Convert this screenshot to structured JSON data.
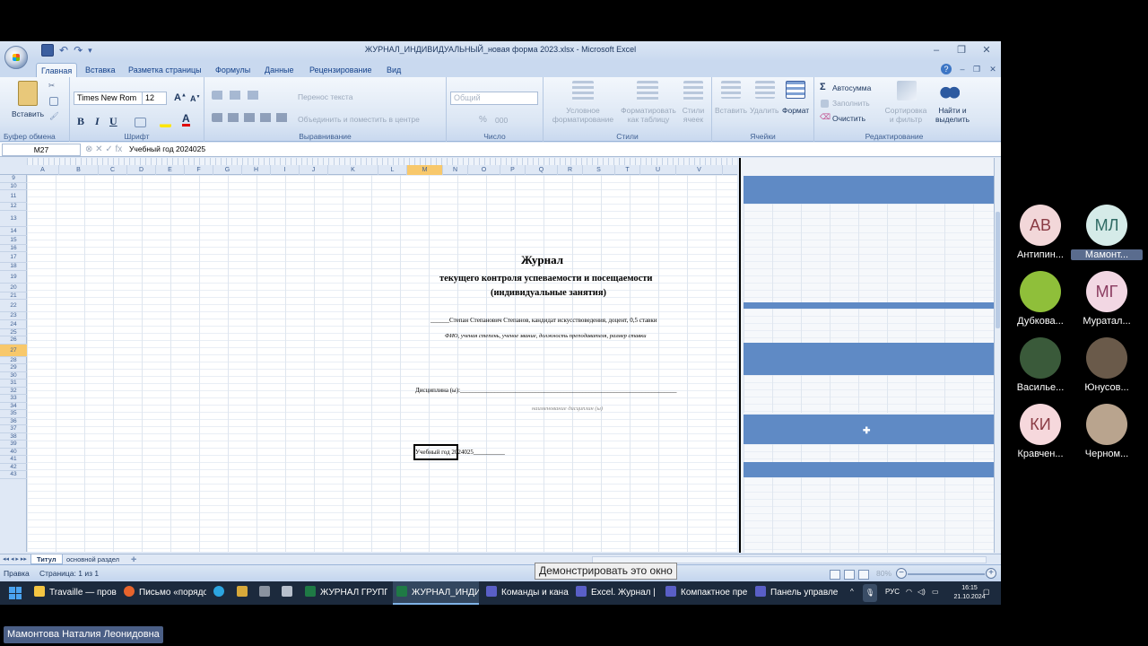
{
  "window": {
    "title": "ЖУРНАЛ_ИНДИВИДУАЛЬНЫЙ_новая форма 2023.xlsx - Microsoft Excel",
    "minimize": "–",
    "maximize": "❐",
    "close": "✕"
  },
  "tabs": [
    "Главная",
    "Вставка",
    "Разметка страницы",
    "Формулы",
    "Данные",
    "Рецензирование",
    "Вид"
  ],
  "ribbon": {
    "clipboard": {
      "label": "Буфер обмена",
      "paste": "Вставить"
    },
    "font": {
      "label": "Шрифт",
      "name": "Times New Rom",
      "size": "12",
      "bold": "B",
      "italic": "I",
      "underline": "U",
      "font_color_letter": "A"
    },
    "alignment": {
      "label": "Выравнивание",
      "wrap": "Перенос текста",
      "merge": "Объединить и поместить в центре"
    },
    "number": {
      "label": "Число",
      "format": "Общий",
      "percent": "%",
      "thousands": "000"
    },
    "styles": {
      "label": "Стили",
      "cond": "Условное форматирование",
      "as_table": "Форматировать как таблицу",
      "cell_styles": "Стили ячеек"
    },
    "cells": {
      "label": "Ячейки",
      "insert": "Вставить",
      "delete": "Удалить",
      "format": "Формат"
    },
    "editing": {
      "label": "Редактирование",
      "autosum": "Автосумма",
      "fill": "Заполнить",
      "clear": "Очистить",
      "sort": "Сортировка и фильтр",
      "find": "Найти и выделить"
    }
  },
  "formula_bar": {
    "name_box": "M27",
    "content": "Учебный год 2024025"
  },
  "columns": [
    "A",
    "B",
    "C",
    "D",
    "E",
    "F",
    "G",
    "H",
    "I",
    "J",
    "K",
    "L",
    "M",
    "N",
    "O",
    "P",
    "Q",
    "R",
    "S",
    "T",
    "U",
    "V"
  ],
  "rows": [
    "9",
    "10",
    "11",
    "12",
    "13",
    "14",
    "15",
    "16",
    "17",
    "18",
    "19",
    "20",
    "21",
    "22",
    "23",
    "24",
    "25",
    "26",
    "27",
    "28",
    "29",
    "30",
    "31",
    "32",
    "33",
    "34",
    "35",
    "36",
    "37",
    "38",
    "39",
    "40",
    "41",
    "42",
    "43"
  ],
  "document": {
    "title": "Журнал",
    "subtitle1": "текущего контроля успеваемости и посещаемости",
    "subtitle2": "(индивидуальные занятия)",
    "teacher": "______Степан Степанович Степанов, кандидат искусствоведения, доцент, 0,5 ставки",
    "teacher_hint": "ФИО, ученая степень, ученое звание, должность преподавателя, размер ставки",
    "discipline": "Дисциплина (ы):_____________________________________________________________________",
    "discipline_hint": "наименование дисциплин (ы)",
    "year": "Учебный год 2024025__________"
  },
  "sheet_tabs": [
    "Титул",
    "основной раздел"
  ],
  "status": {
    "mode": "Правка",
    "page": "Страница: 1 из 1",
    "zoom": "80%"
  },
  "tooltip": "Демонстрировать это окно",
  "taskbar": {
    "items": [
      "Travaille — пров",
      "Письмо «порядо",
      "ЖУРНАЛ ГРУПП",
      "ЖУРНАЛ_ИНДИ",
      "Команды и кана",
      "Excel. Журнал | М",
      "Компактное пре",
      "Панель управле"
    ],
    "lang": "РУС",
    "time": "16:15",
    "date": "21.10.2024"
  },
  "participants": [
    {
      "initials": "АВ",
      "name": "Антипин...",
      "color": "#f2d7d9",
      "text": "#8a3b44"
    },
    {
      "initials": "МЛ",
      "name": "Мамонт...",
      "color": "#d5ebe8",
      "text": "#2f6a63"
    },
    {
      "initials": "",
      "name": "Дубкова...",
      "color": "#8fbf3a",
      "text": "#ffffff"
    },
    {
      "initials": "МГ",
      "name": "Муратал...",
      "color": "#f2d7e3",
      "text": "#8a3b60"
    },
    {
      "initials": "",
      "name": "Василье...",
      "color": "#3a5a3a",
      "text": "#ffffff"
    },
    {
      "initials": "",
      "name": "Юнусов...",
      "color": "#6a5a4a",
      "text": "#ffffff"
    },
    {
      "initials": "КИ",
      "name": "Кравчен...",
      "color": "#f6d8dc",
      "text": "#8a3b44"
    },
    {
      "initials": "",
      "name": "Черном...",
      "color": "#b9a48e",
      "text": "#ffffff"
    }
  ],
  "speaker": "Мамонтова Наталия Леонидовна"
}
